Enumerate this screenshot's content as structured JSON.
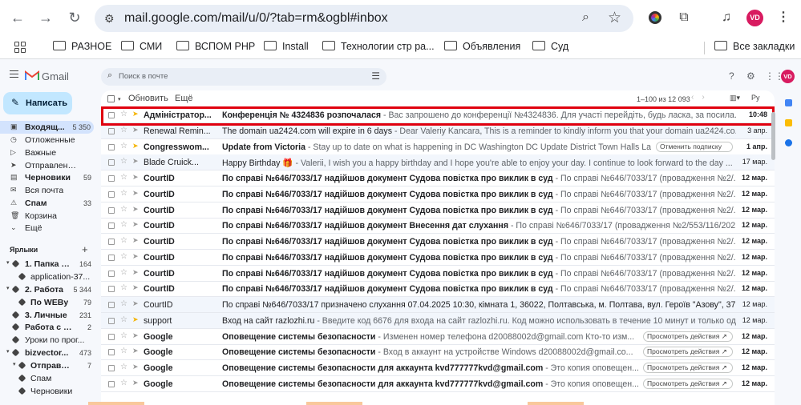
{
  "browser": {
    "url": "mail.google.com/mail/u/0/?tab=rm&ogbl#inbox",
    "avatar_initials": "VD",
    "bookmarks": [
      "РАЗНОЕ",
      "СМИ",
      "ВСПОМ PHP",
      "Install",
      "Технологии стр ра...",
      "Объявления",
      "Суд"
    ],
    "all_bookmarks": "Все закладки"
  },
  "gmail": {
    "brand": "Gmail",
    "search_placeholder": "Поиск в почте",
    "compose": "Написать",
    "toolbar": {
      "refresh": "Обновить",
      "more": "Ещё",
      "range": "1–100 из 12 093",
      "sort": "Ру"
    },
    "nav": [
      {
        "label": "Входящ...",
        "count": "5 350",
        "icon": "▣",
        "bold": true,
        "active": true
      },
      {
        "label": "Отложенные",
        "count": "",
        "icon": "◷",
        "bold": false
      },
      {
        "label": "Важные",
        "count": "",
        "icon": "▷",
        "bold": false
      },
      {
        "label": "Отправленные",
        "count": "",
        "icon": "➤",
        "bold": false
      },
      {
        "label": "Черновики",
        "count": "59",
        "icon": "▤",
        "bold": true
      },
      {
        "label": "Вся почта",
        "count": "",
        "icon": "✉",
        "bold": false
      },
      {
        "label": "Спам",
        "count": "33",
        "icon": "⚠",
        "bold": true
      },
      {
        "label": "Корзина",
        "count": "",
        "icon": "🗑",
        "bold": false
      },
      {
        "label": "Ещё",
        "count": "",
        "icon": "⌄",
        "bold": false
      }
    ],
    "labels_header": "Ярлыки",
    "labels": [
      {
        "label": "1. Папка м...",
        "count": "164",
        "indent": 0,
        "bold": true,
        "arrow": true
      },
      {
        "label": "application-37...",
        "count": "",
        "indent": 1,
        "bold": false,
        "arrow": false
      },
      {
        "label": "2. Работа",
        "count": "5 344",
        "indent": 0,
        "bold": true,
        "arrow": true
      },
      {
        "label": "По WEBу",
        "count": "79",
        "indent": 1,
        "bold": true,
        "arrow": false
      },
      {
        "label": "3. Личные",
        "count": "231",
        "indent": 0,
        "bold": true,
        "arrow": false
      },
      {
        "label": "Работа с об...",
        "count": "2",
        "indent": 0,
        "bold": true,
        "arrow": false
      },
      {
        "label": "Уроки по прог...",
        "count": "",
        "indent": 0,
        "bold": false,
        "arrow": false
      },
      {
        "label": "bizvector...",
        "count": "473",
        "indent": 0,
        "bold": true,
        "arrow": true
      },
      {
        "label": "Отправле...",
        "count": "7",
        "indent": 1,
        "bold": true,
        "arrow": true
      },
      {
        "label": "Спам",
        "count": "",
        "indent": 1,
        "bold": false,
        "arrow": false
      },
      {
        "label": "Черновики",
        "count": "",
        "indent": 1,
        "bold": false,
        "arrow": false
      }
    ],
    "emails": [
      {
        "sender": "Адміністратор...",
        "subject": "Конференція № 4324836 розпочалася",
        "snippet": " - Вас запрошено до конференції №4324836. Для участі перейдіть, будь ласка, за посила...",
        "date": "10:48",
        "unread": true,
        "important": true,
        "chip": ""
      },
      {
        "sender": "Renewal Remin...",
        "subject": "The domain ua2424.com will expire in 6 days",
        "snippet": " - Dear Valeriy Kancara, This is a reminder to kindly inform you that your domain ua2424.co...",
        "date": "3 апр.",
        "unread": false,
        "important": false,
        "chip": ""
      },
      {
        "sender": "Congresswom...",
        "subject": "Update from Victoria",
        "snippet": " - Stay up to date on what is happening in DC Washington DC Update District Town Halls La...",
        "date": "1 апр.",
        "unread": true,
        "important": true,
        "chip": "Отменить подписку"
      },
      {
        "sender": "Blade Cruick...",
        "subject": "Happy Birthday 🎁",
        "snippet": " - Valerii, I wish you a happy birthday and I hope you're able to enjoy your day. I continue to look forward to the day ...",
        "date": "17 мар.",
        "unread": false,
        "important": false,
        "chip": ""
      },
      {
        "sender": "CourtID",
        "subject": "По справі №646/7033/17 надійшов документ Судова повістка про виклик в суд",
        "snippet": " - По справі №646/7033/17 (провадження №2/...",
        "date": "12 мар.",
        "unread": true,
        "important": false,
        "chip": ""
      },
      {
        "sender": "CourtID",
        "subject": "По справі №646/7033/17 надійшов документ Судова повістка про виклик в суд",
        "snippet": " - По справі №646/7033/17 (провадження №2/...",
        "date": "12 мар.",
        "unread": true,
        "important": false,
        "chip": ""
      },
      {
        "sender": "CourtID",
        "subject": "По справі №646/7033/17 надійшов документ Судова повістка про виклик в суд",
        "snippet": " - По справі №646/7033/17 (провадження №2/...",
        "date": "12 мар.",
        "unread": true,
        "important": false,
        "chip": ""
      },
      {
        "sender": "CourtID",
        "subject": "По справі №646/7033/17 надійшов документ Внесення дат слухання",
        "snippet": " - По справі №646/7033/17 (провадження №2/553/116/202...",
        "date": "12 мар.",
        "unread": true,
        "important": false,
        "chip": ""
      },
      {
        "sender": "CourtID",
        "subject": "По справі №646/7033/17 надійшов документ Судова повістка про виклик в суд",
        "snippet": " - По справі №646/7033/17 (провадження №2/...",
        "date": "12 мар.",
        "unread": true,
        "important": false,
        "chip": ""
      },
      {
        "sender": "CourtID",
        "subject": "По справі №646/7033/17 надійшов документ Судова повістка про виклик в суд",
        "snippet": " - По справі №646/7033/17 (провадження №2/...",
        "date": "12 мар.",
        "unread": true,
        "important": false,
        "chip": ""
      },
      {
        "sender": "CourtID",
        "subject": "По справі №646/7033/17 надійшов документ Судова повістка про виклик в суд",
        "snippet": " - По справі №646/7033/17 (провадження №2/...",
        "date": "12 мар.",
        "unread": true,
        "important": false,
        "chip": ""
      },
      {
        "sender": "CourtID",
        "subject": "По справі №646/7033/17 надійшов документ Судова повістка про виклик в суд",
        "snippet": " - По справі №646/7033/17 (провадження №2/...",
        "date": "12 мар.",
        "unread": true,
        "important": false,
        "chip": ""
      },
      {
        "sender": "CourtID",
        "subject": "По справі №646/7033/17 призначено слухання 07.04.2025 10:30, кімната 1, 36022, Полтавська, м. Полтава, вул. Героїв \"Азову\", 37",
        "snippet": " - П...",
        "date": "12 мар.",
        "unread": false,
        "important": false,
        "chip": ""
      },
      {
        "sender": "support",
        "subject": "Вход на сайт razlozhi.ru",
        "snippet": " - Введите код 6676 для входа на сайт razlozhi.ru. Код можно использовать в течение 10 минут и только од...",
        "date": "12 мар.",
        "unread": false,
        "important": true,
        "chip": ""
      },
      {
        "sender": "Google",
        "subject": "Оповещение системы безопасности",
        "snippet": " - Изменен номер телефона d20088002d@gmail.com Кто-то изм...",
        "date": "12 мар.",
        "unread": true,
        "important": false,
        "chip": "Просмотреть действия ↗"
      },
      {
        "sender": "Google",
        "subject": "Оповещение системы безопасности",
        "snippet": " - Вход в аккаунт на устройстве Windows d20088002d@gmail.co...",
        "date": "12 мар.",
        "unread": true,
        "important": false,
        "chip": "Просмотреть действия ↗"
      },
      {
        "sender": "Google",
        "subject": "Оповещение системы безопасности для аккаунта kvd777777kvd@gmail.com",
        "snippet": " - Это копия оповещен...",
        "date": "12 мар.",
        "unread": true,
        "important": false,
        "chip": "Просмотреть действия ↗"
      },
      {
        "sender": "Google",
        "subject": "Оповещение системы безопасности для аккаунта kvd777777kvd@gmail.com",
        "snippet": " - Это копия оповещен...",
        "date": "12 мар.",
        "unread": true,
        "important": false,
        "chip": "Просмотреть действия ↗"
      }
    ],
    "colors": {
      "highlight": "#e0000f",
      "accent": "#c2e7ff",
      "avatar": "#d81b60"
    }
  }
}
